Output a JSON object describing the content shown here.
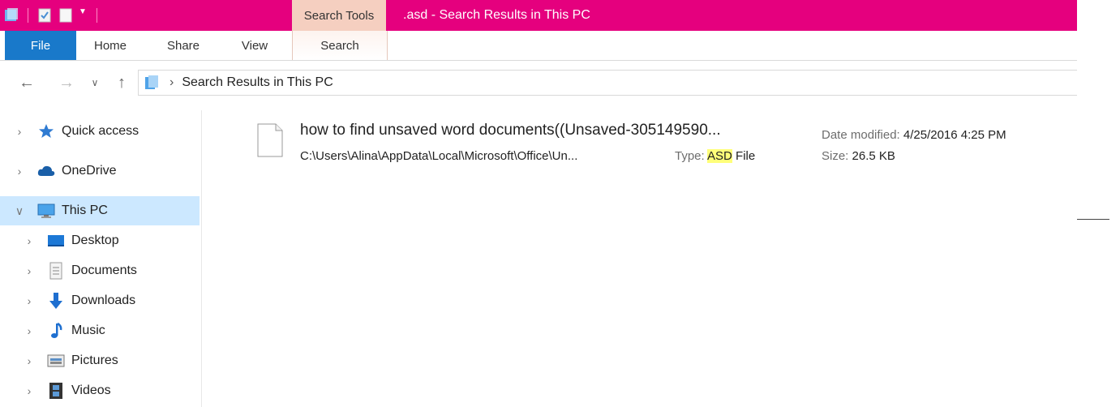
{
  "titlebar": {
    "context_tab_label": "Search Tools",
    "window_title": ".asd - Search Results in This PC",
    "accent_color": "#e5007e"
  },
  "ribbon": {
    "tabs": [
      {
        "label": "File"
      },
      {
        "label": "Home"
      },
      {
        "label": "Share"
      },
      {
        "label": "View"
      },
      {
        "label": "Search"
      }
    ]
  },
  "address": {
    "path": "Search Results in This PC",
    "icon": "this-pc-icon"
  },
  "navpane": {
    "items": [
      {
        "label": "Quick access",
        "icon": "star-icon"
      },
      {
        "label": "OneDrive",
        "icon": "cloud-icon"
      },
      {
        "label": "This PC",
        "icon": "computer-icon",
        "selected": true
      },
      {
        "label": "Desktop",
        "icon": "desktop-icon"
      },
      {
        "label": "Documents",
        "icon": "documents-icon"
      },
      {
        "label": "Downloads",
        "icon": "download-arrow-icon"
      },
      {
        "label": "Music",
        "icon": "music-note-icon"
      },
      {
        "label": "Pictures",
        "icon": "pictures-icon"
      },
      {
        "label": "Videos",
        "icon": "film-icon"
      }
    ]
  },
  "result": {
    "name": "how to find unsaved word documents((Unsaved-305149590...",
    "path": "C:\\Users\\Alina\\AppData\\Local\\Microsoft\\Office\\Un...",
    "type_label": "Type:",
    "type_highlight": "ASD",
    "type_rest": " File",
    "date_label": "Date modified:",
    "date_value": "4/25/2016 4:25 PM",
    "size_label": "Size:",
    "size_value": "26.5 KB"
  }
}
